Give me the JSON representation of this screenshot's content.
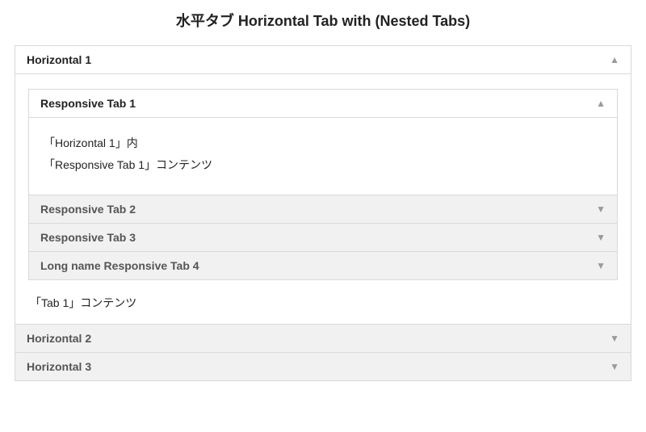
{
  "title": "水平タブ Horizontal Tab with (Nested Tabs)",
  "outer": {
    "tab1": {
      "label": "Horizontal 1",
      "footer": "「Tab 1」コンテンツ",
      "nested": {
        "r1": {
          "label": "Responsive Tab 1",
          "line1": "「Horizontal 1」内",
          "line2": "「Responsive Tab 1」コンテンツ"
        },
        "r2": {
          "label": "Responsive Tab 2"
        },
        "r3": {
          "label": "Responsive Tab 3"
        },
        "r4": {
          "label": "Long name Responsive Tab 4"
        }
      }
    },
    "tab2": {
      "label": "Horizontal 2"
    },
    "tab3": {
      "label": "Horizontal 3"
    }
  }
}
